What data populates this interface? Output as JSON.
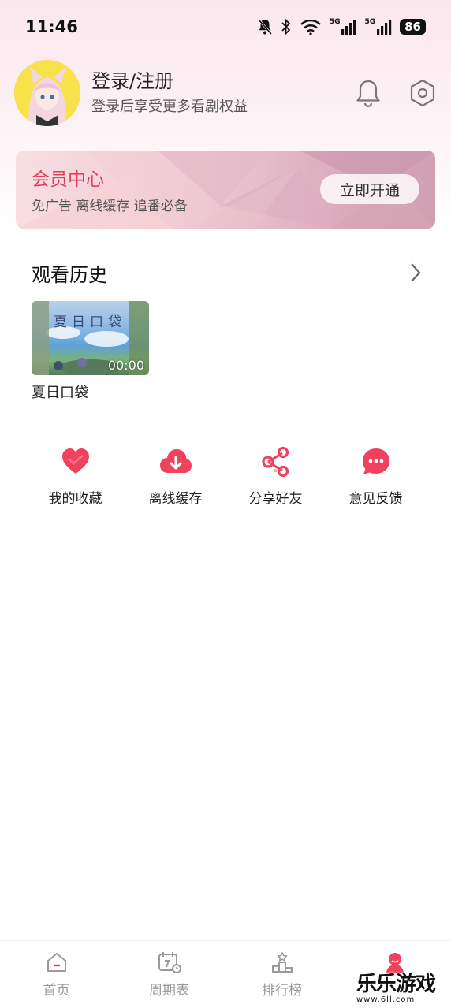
{
  "status_bar": {
    "time": "11:46",
    "network1": "5G",
    "network2": "5G",
    "battery": "86"
  },
  "profile": {
    "login_title": "登录/注册",
    "login_sub": "登录后享受更多看剧权益"
  },
  "member": {
    "title": "会员中心",
    "subtitle": "免广告 离线缓存 追番必备",
    "button": "立即开通",
    "accent_color": "#e0405e"
  },
  "history": {
    "title": "观看历史",
    "items": [
      {
        "name": "夏日口袋",
        "time": "00:00",
        "thumb_title": "夏日口袋"
      }
    ]
  },
  "quick_actions": [
    {
      "label": "我的收藏",
      "icon": "heart-icon"
    },
    {
      "label": "离线缓存",
      "icon": "cloud-download-icon"
    },
    {
      "label": "分享好友",
      "icon": "share-icon"
    },
    {
      "label": "意见反馈",
      "icon": "chat-feedback-icon"
    }
  ],
  "bottom_nav": [
    {
      "label": "首页",
      "icon": "home-icon"
    },
    {
      "label": "周期表",
      "icon": "calendar-icon"
    },
    {
      "label": "排行榜",
      "icon": "podium-icon"
    },
    {
      "label": "",
      "icon": "profile-icon"
    }
  ],
  "watermark": {
    "text": "乐乐游戏",
    "url": "www.6ll.com"
  }
}
